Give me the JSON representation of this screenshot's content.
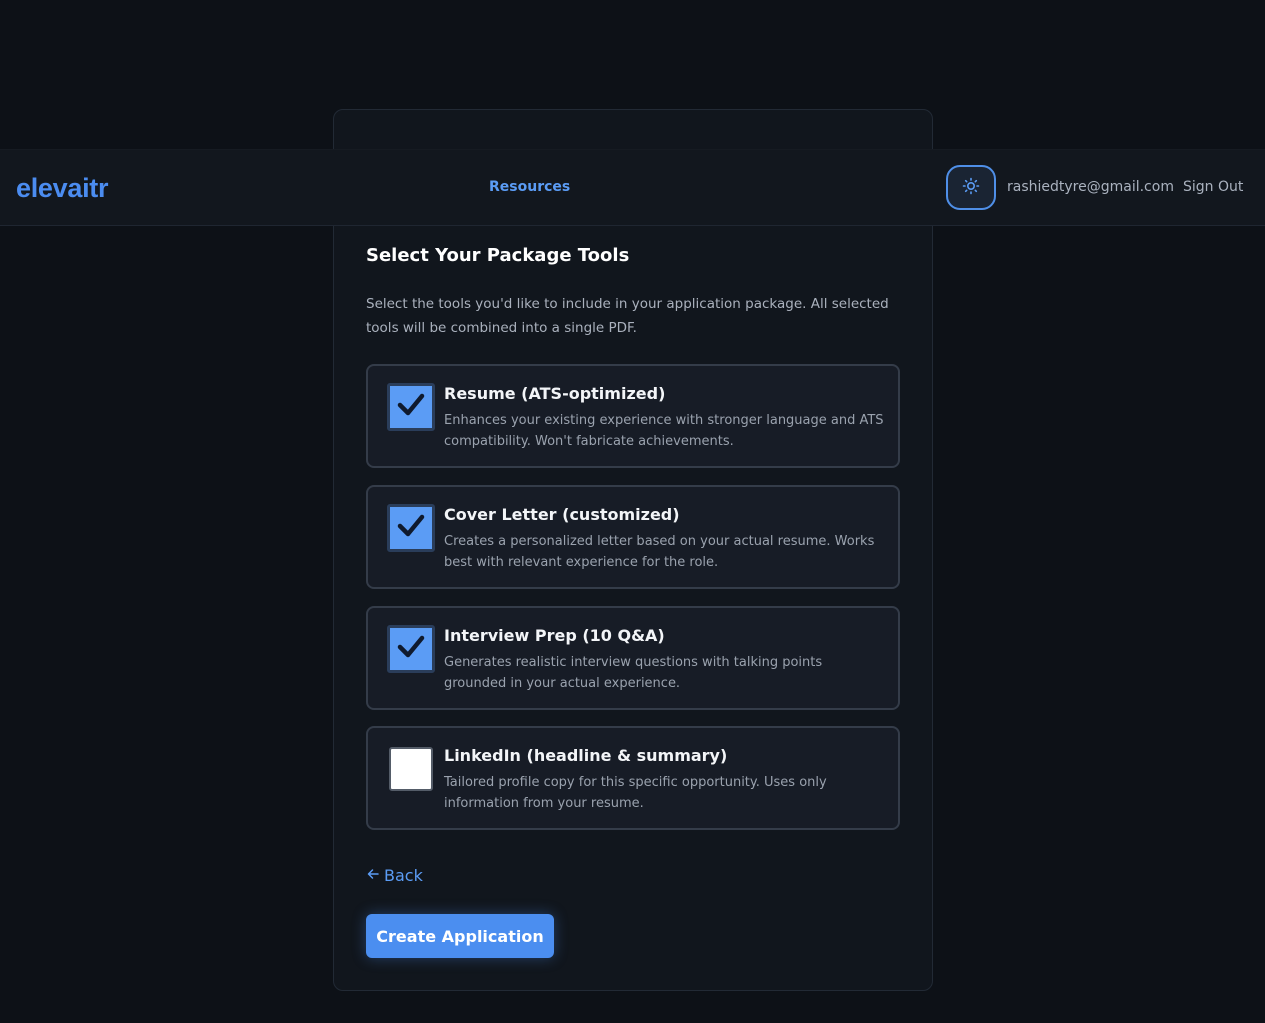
{
  "header": {
    "brand": "elevaitr",
    "nav_link": "Resources",
    "theme_toggle_icon": "sun-icon",
    "user_email": "rashiedtyre@gmail.com",
    "sign_out": "Sign Out"
  },
  "section": {
    "title": "Select Your Package Tools",
    "description": "Select the tools you'd like to include in your application package. All selected tools will be combined into a single PDF."
  },
  "tools": [
    {
      "title": "Resume (ATS-optimized)",
      "description": "Enhances your existing experience with stronger language and ATS compatibility. Won't fabricate achievements.",
      "checked": true
    },
    {
      "title": "Cover Letter (customized)",
      "description": "Creates a personalized letter based on your actual resume. Works best with relevant experience for the role.",
      "checked": true
    },
    {
      "title": "Interview Prep (10 Q&A)",
      "description": "Generates realistic interview questions with talking points grounded in your actual experience.",
      "checked": true
    },
    {
      "title": "LinkedIn (headline & summary)",
      "description": "Tailored profile copy for this specific opportunity. Uses only information from your resume.",
      "checked": false
    }
  ],
  "actions": {
    "back": "Back",
    "back_icon": "arrow-left-icon",
    "create": "Create Application"
  },
  "colors": {
    "accent": "#4b8ef0",
    "background": "#0d1117",
    "card": "#11161d"
  }
}
